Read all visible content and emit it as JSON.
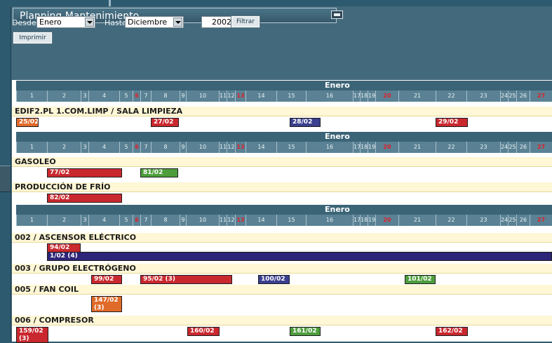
{
  "window": {
    "title": "Planning Mantenimiento"
  },
  "filters": {
    "desde_label": "Desde",
    "desde_value": "Enero",
    "hasta_label": "Hasta",
    "hasta_value": "Diciembre",
    "year": "2002",
    "filtrar_label": "Filtrar",
    "imprimir_label": "Imprimir"
  },
  "calendar": {
    "month": "Enero",
    "days": [
      "1",
      "2",
      "3",
      "4",
      "5",
      "6",
      "7",
      "8",
      "9",
      "10",
      "11",
      "12",
      "13",
      "14",
      "15",
      "16",
      "17",
      "18",
      "19",
      "20",
      "21",
      "22",
      "23",
      "24",
      "25",
      "26",
      "27"
    ],
    "holidays": [
      "6",
      "13",
      "20",
      "27"
    ]
  },
  "sections": [
    {
      "groups": [
        {
          "name": "EDIF2.PL 1.COM.LIMP / SALA LIMPIEZA",
          "tasks": [
            {
              "label": "25/02",
              "color": "#e06a2a"
            },
            {
              "label": "27/02",
              "color": "#c8282e"
            },
            {
              "label": "28/02",
              "color": "#3a3f8f"
            },
            {
              "label": "29/02",
              "color": "#c8282e"
            }
          ]
        }
      ]
    },
    {
      "groups": [
        {
          "name": "GASOLEO",
          "tasks": [
            {
              "label": "77/02",
              "color": "#c8282e"
            },
            {
              "label": "81/02",
              "color": "#4e9d3d"
            }
          ]
        },
        {
          "name": "PRODUCCIÓN DE FRÍO",
          "tasks": [
            {
              "label": "82/02",
              "color": "#c8282e"
            }
          ]
        }
      ]
    },
    {
      "groups": [
        {
          "name": "002 / ASCENSOR ELÉCTRICO",
          "tasks": [
            {
              "label": "94/02",
              "color": "#c8282e"
            },
            {
              "label": "1/02 (4)",
              "color": "#2c2578"
            }
          ]
        },
        {
          "name": "003 / GRUPO ELECTRÓGENO",
          "tasks": [
            {
              "label": "99/02",
              "color": "#c8282e"
            },
            {
              "label": "95/02 (3)",
              "color": "#c8282e"
            },
            {
              "label": "100/02",
              "color": "#3a3f8f"
            },
            {
              "label": "101/02",
              "color": "#4e9d3d"
            }
          ]
        },
        {
          "name": "005 / FAN COIL",
          "tasks": [
            {
              "label": "147/02",
              "sub": "(3)",
              "color": "#e06a2a"
            }
          ]
        },
        {
          "name": "006 / COMPRESOR",
          "tasks": [
            {
              "label": "159/02",
              "sub": "(3)",
              "color": "#c8282e"
            },
            {
              "label": "160/02",
              "color": "#c8282e"
            },
            {
              "label": "161/02",
              "color": "#4e9d3d"
            },
            {
              "label": "162/02",
              "color": "#c8282e"
            }
          ]
        }
      ]
    }
  ]
}
